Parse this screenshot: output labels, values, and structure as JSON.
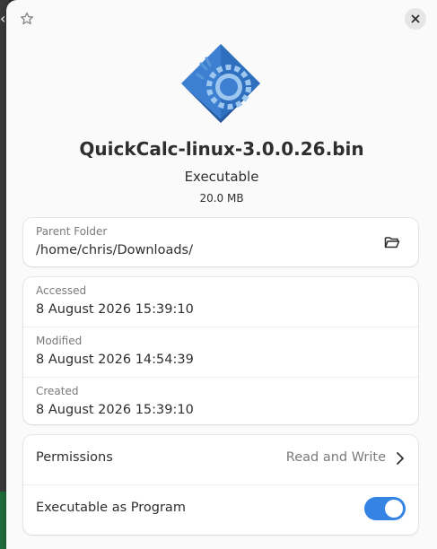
{
  "header": {
    "star_icon": "star-outline-icon",
    "close_icon": "close-icon"
  },
  "file": {
    "name": "QuickCalc-linux-3.0.0.26.bin",
    "type": "Executable",
    "size": "20.0 MB",
    "icon": "gear-application-icon",
    "icon_colors": {
      "primary": "#3d7fd0",
      "dark": "#2a5faa",
      "light": "#9ec7f0"
    }
  },
  "location": {
    "label": "Parent Folder",
    "value": "/home/chris/Downloads/",
    "action_icon": "open-folder-icon"
  },
  "dates": [
    {
      "label": "Accessed",
      "value": "8 August 2026 15:39:10"
    },
    {
      "label": "Modified",
      "value": "8 August 2026 14:54:39"
    },
    {
      "label": "Created",
      "value": "8 August 2026 15:39:10"
    }
  ],
  "permissions": {
    "label": "Permissions",
    "value": "Read and Write",
    "chevron_icon": "chevron-right-icon"
  },
  "executable": {
    "label": "Executable as Program",
    "enabled": true,
    "accent": "#3584e4"
  }
}
